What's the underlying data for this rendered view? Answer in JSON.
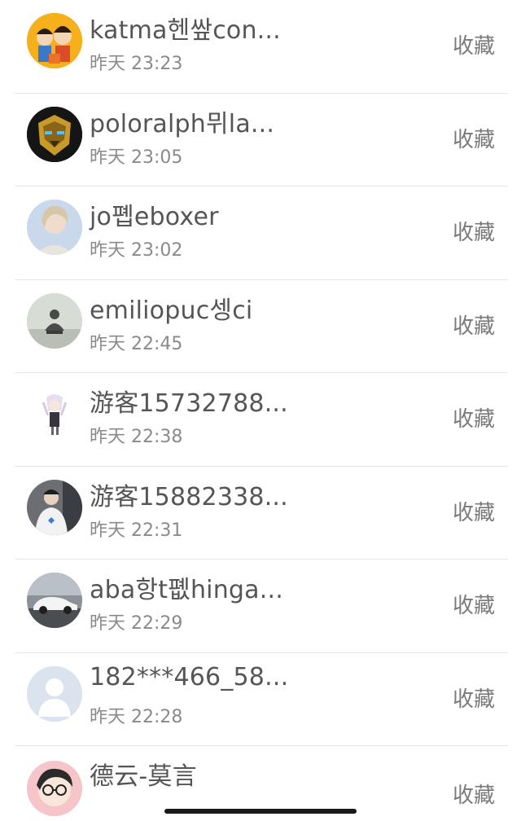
{
  "items": [
    {
      "name": "katma헨쌒con...",
      "time": "昨天 23:23",
      "action": "收藏",
      "avatar": "cartoon-family-avatar"
    },
    {
      "name": "poloralph뮈la...",
      "time": "昨天 23:05",
      "action": "收藏",
      "avatar": "robot-helmet-avatar"
    },
    {
      "name": "jo폡eboxer",
      "time": "昨天 23:02",
      "action": "收藏",
      "avatar": "woman-portrait-avatar"
    },
    {
      "name": "emiliopuc셍ci",
      "time": "昨天 22:45",
      "action": "收藏",
      "avatar": "buddha-statue-avatar"
    },
    {
      "name": "游客15732788...",
      "time": "昨天 22:38",
      "action": "收藏",
      "avatar": "anime-girl-avatar"
    },
    {
      "name": "游客15882338...",
      "time": "昨天 22:31",
      "action": "收藏",
      "avatar": "hoodie-boy-avatar"
    },
    {
      "name": "aba항t폢hinga...",
      "time": "昨天 22:29",
      "action": "收藏",
      "avatar": "sports-car-avatar"
    },
    {
      "name": "182***466_58...",
      "time": "昨天 22:28",
      "action": "收藏",
      "avatar": "default-person-avatar"
    },
    {
      "name": "德云-莫言",
      "time": "",
      "action": "收藏",
      "avatar": "cartoon-glasses-avatar"
    }
  ]
}
